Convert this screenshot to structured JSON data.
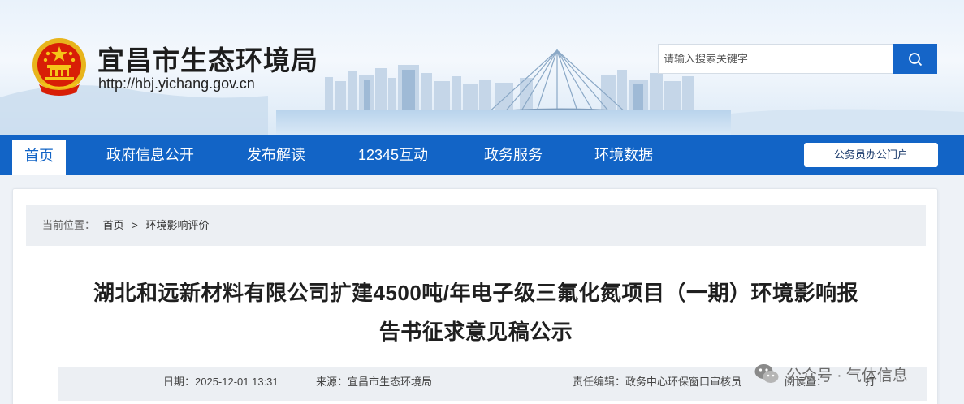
{
  "header": {
    "site_title": "宜昌市生态环境局",
    "site_url": "http://hbj.yichang.gov.cn",
    "emblem_icon": "national-emblem-icon",
    "search_placeholder": "请输入搜索关键字",
    "search_icon": "search-icon"
  },
  "nav": {
    "items": [
      {
        "label": "首页",
        "active": true
      },
      {
        "label": "政府信息公开"
      },
      {
        "label": "发布解读"
      },
      {
        "label": "12345互动"
      },
      {
        "label": "政务服务"
      },
      {
        "label": "环境数据"
      }
    ],
    "portal_button": "公务员办公门户"
  },
  "breadcrumb": {
    "label": "当前位置：",
    "items": [
      "首页",
      ">",
      "环境影响评价"
    ]
  },
  "article": {
    "title_line1": "湖北和远新材料有限公司扩建4500吨/年电子级三氟化氮项目（一期）环境影响报",
    "title_line2": "告书征求意见稿公示",
    "meta": {
      "date": "日期：2025-12-01 13:31",
      "source": "来源：宜昌市生态环境局",
      "editor": "责任编辑：政务中心环保窗口审核员",
      "views": "阅读量：",
      "print": "打"
    }
  },
  "watermark": {
    "text": "公众号 · 气体信息",
    "icon": "wechat-icon"
  },
  "colors": {
    "nav_blue": "#1264c6",
    "search_blue": "#1565c8",
    "emblem_red": "#d81e06",
    "emblem_gold": "#f5c518"
  }
}
